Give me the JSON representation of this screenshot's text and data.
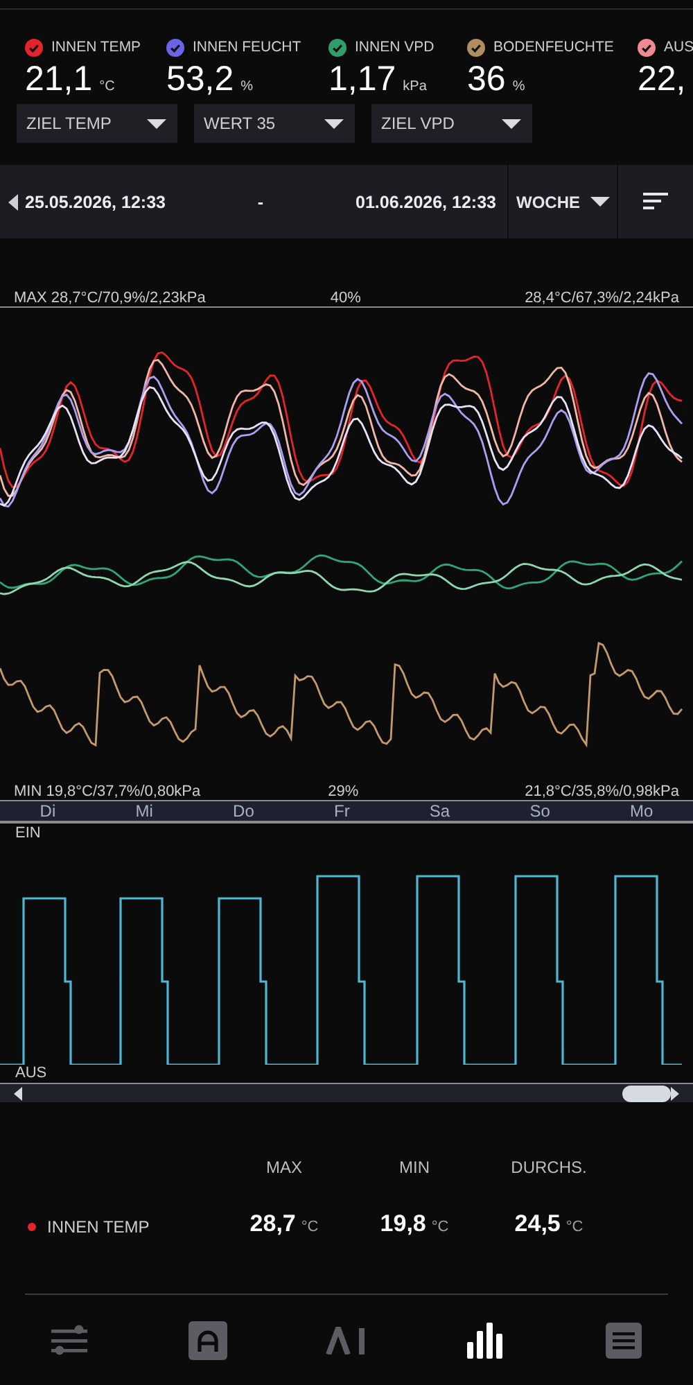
{
  "sensors": [
    {
      "label": "INNEN TEMP",
      "value": "21,1",
      "unit": "°C",
      "color": "#e3242b",
      "checked": true
    },
    {
      "label": "INNEN FEUCHT",
      "value": "53,2",
      "unit": "%",
      "color": "#6b64e8",
      "checked": true
    },
    {
      "label": "INNEN VPD",
      "value": "1,17",
      "unit": "kPa",
      "color": "#2f9e6a",
      "checked": true
    },
    {
      "label": "BODENFEUCHTE",
      "value": "36",
      "unit": "%",
      "color": "#b08d5f",
      "checked": true
    },
    {
      "label": "AUS",
      "value": "22,",
      "color": "#ef8a92",
      "checked": true
    }
  ],
  "targets": [
    "ZIEL TEMP",
    "WERT 35",
    "ZIEL VPD"
  ],
  "date_bar": {
    "start": "25.05.2026, 12:33",
    "separator": "-",
    "end": "01.06.2026, 12:33",
    "range": "WOCHE"
  },
  "chart": {
    "max_left": "MAX 28,7°C/70,9%/2,23kPa",
    "max_mid": "40%",
    "max_right": "28,4°C/67,3%/2,24kPa",
    "min_left": "MIN 19,8°C/37,7%/0,80kPa",
    "min_mid": "29%",
    "min_right": "21,8°C/35,8%/0,98kPa"
  },
  "days": [
    "Di",
    "Mi",
    "Do",
    "Fr",
    "Sa",
    "So",
    "Mo"
  ],
  "switch_chart": {
    "on_label": "EIN",
    "off_label": "AUS"
  },
  "stats": {
    "headers": [
      "MAX",
      "MIN",
      "DURCHS."
    ],
    "rows": [
      {
        "label": "INNEN TEMP",
        "color": "#e3242b",
        "values": [
          {
            "value": "28,7",
            "unit": "°C"
          },
          {
            "value": "19,8",
            "unit": "°C"
          },
          {
            "value": "24,5",
            "unit": "°C"
          }
        ]
      }
    ]
  },
  "nav": [
    {
      "kind": "sliders",
      "selected": false
    },
    {
      "kind": "gauge",
      "selected": false
    },
    {
      "kind": "ai",
      "selected": false
    },
    {
      "kind": "chart",
      "selected": true
    },
    {
      "kind": "list",
      "selected": false
    }
  ]
}
